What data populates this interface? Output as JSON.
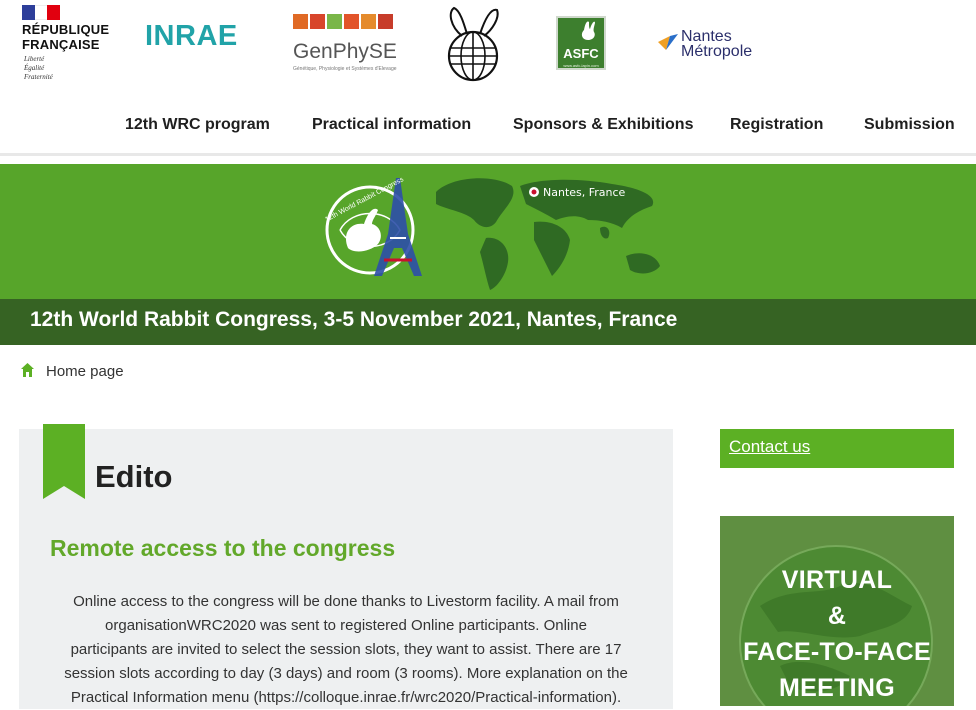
{
  "partners": {
    "republique": {
      "title_line1": "RÉPUBLIQUE",
      "title_line2": "FRANÇAISE",
      "motto_line1": "Liberté",
      "motto_line2": "Égalité",
      "motto_line3": "Fraternité"
    },
    "inrae": "INRAE",
    "genphyse": {
      "name": "GenPhySE",
      "tagline": "Génétique, Physiologie et Systèmes d'Elevage"
    },
    "asfc": {
      "name": "ASFC",
      "url": "www.asfc-lapin.com"
    },
    "nantes": {
      "line1": "Nantes",
      "line2": "Métropole"
    }
  },
  "nav": {
    "items": [
      "12th WRC program",
      "Practical information",
      "Sponsors & Exhibitions",
      "Registration",
      "Submission"
    ]
  },
  "banner": {
    "emblem_text": "12th World Rabbit Congress",
    "location_label": "Nantes, France"
  },
  "page": {
    "title": "12th World Rabbit Congress, 3-5 November 2021, Nantes, France"
  },
  "breadcrumb": {
    "home": "Home page"
  },
  "edito": {
    "title": "Edito",
    "heading": "Remote access to the congress",
    "body_lines": [
      "Online access to the congress will be done thanks to Livestorm facility. A mail from",
      "organisationWRC2020 was sent to registered Online participants.  Online",
      "participants are invited to select the session slots, they want to assist. There are 17",
      "session slots according to day (3 days) and room (3 rooms). More explanation on the",
      "Practical Information menu (https://colloque.inrae.fr/wrc2020/Practical-information)."
    ]
  },
  "sidebar": {
    "contact_label": "Contact us",
    "promo": {
      "line1": "VIRTUAL",
      "line2": "&",
      "line3": "FACE-TO-FACE",
      "line4": "MEETING"
    }
  },
  "colors": {
    "brand_green": "#57a52a",
    "dark_green": "#366323",
    "heading_green": "#62a82a",
    "inrae_teal": "#21a3a8"
  }
}
